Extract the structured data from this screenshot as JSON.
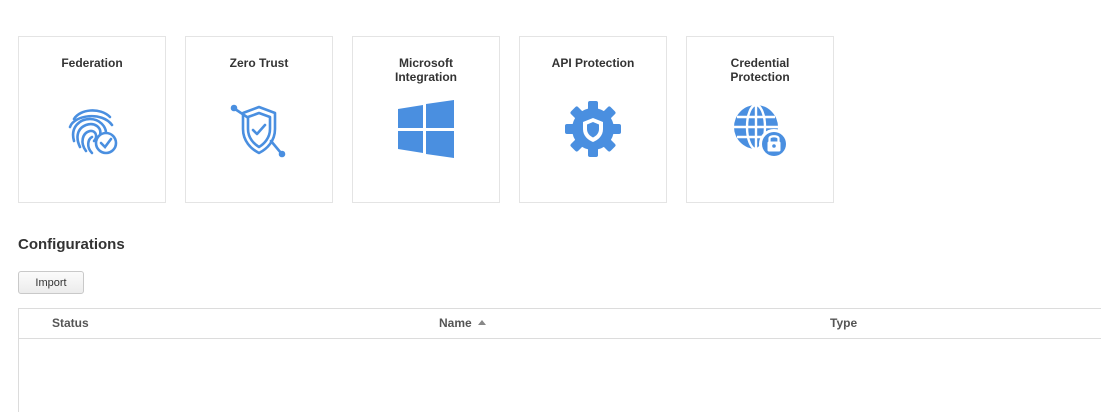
{
  "tiles": [
    {
      "title": "Federation",
      "icon": "fingerprint-check-icon"
    },
    {
      "title": "Zero Trust",
      "icon": "shield-check-icon"
    },
    {
      "title": "Microsoft\nIntegration",
      "icon": "windows-logo-icon"
    },
    {
      "title": "API Protection",
      "icon": "gear-shield-icon"
    },
    {
      "title": "Credential\nProtection",
      "icon": "globe-lock-icon"
    }
  ],
  "configurations": {
    "title": "Configurations",
    "import_label": "Import",
    "columns": {
      "status": "Status",
      "name": "Name",
      "type": "Type"
    },
    "sort": {
      "column": "Name",
      "direction": "ascending"
    },
    "rows": []
  },
  "colors": {
    "icon_blue": "#4a8fe0",
    "border": "#e4e4e4"
  }
}
